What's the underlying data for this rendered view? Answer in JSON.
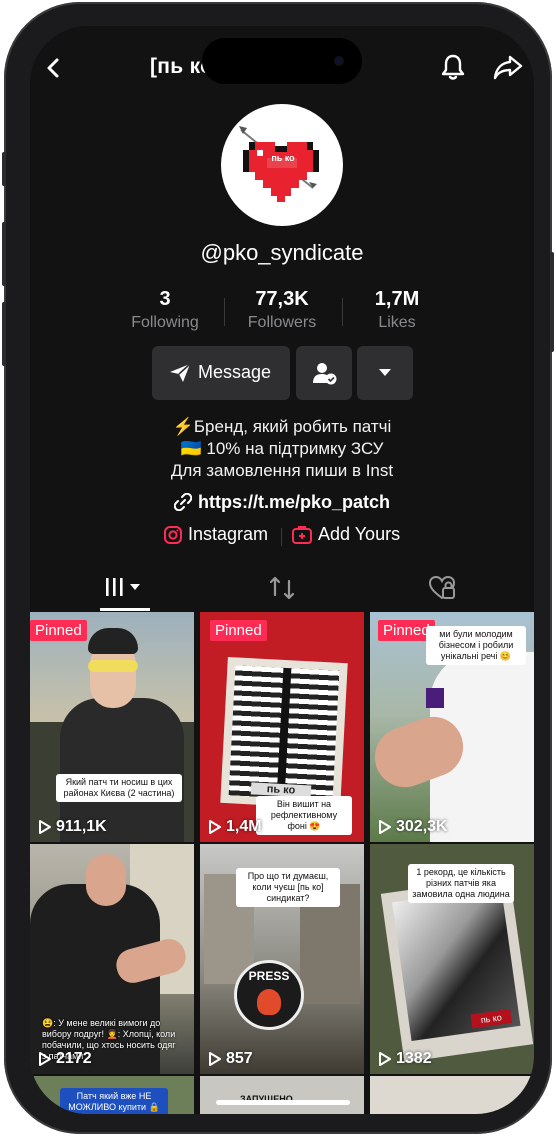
{
  "header": {
    "title": "[пь ко] синдicate",
    "back_icon": "chevron-left-icon",
    "bell_icon": "bell-icon",
    "share_icon": "share-arrow-icon"
  },
  "profile": {
    "avatar_text": "пь ко",
    "username": "@pko_syndicate",
    "stats": [
      {
        "value": "3",
        "label": "Following"
      },
      {
        "value": "77,3K",
        "label": "Followers"
      },
      {
        "value": "1,7M",
        "label": "Likes"
      }
    ],
    "message_label": "Message",
    "bio_lines": [
      "⚡Бренд, який робить патчі",
      "🇺🇦 10% на підтримку ЗСУ",
      "Для замовлення пиши в Inst"
    ],
    "link": "https://t.me/pko_patch",
    "instagram_label": "Instagram",
    "add_yours_label": "Add Yours"
  },
  "videos": [
    {
      "pinned": "Pinned",
      "views": "911,1K",
      "caption": "Який патч ти носиш в цих районах Києва (2 частина)"
    },
    {
      "pinned": "Pinned",
      "views": "1,4M",
      "caption": "Він вишит на рефлективному фоні 😍",
      "patch_text": "пь ко"
    },
    {
      "pinned": "Pinned",
      "views": "302,3K",
      "caption": "ми були молодим бізнесом і робили унікальні речі 😊"
    },
    {
      "views": "2172",
      "caption": "😫: У мене великі вимоги до вибору подруг! 🧑‍🦱: Хлопці, коли побачили, що хтось носить одяг з патчами"
    },
    {
      "views": "857",
      "caption": "Про що ти думаєш, коли чуєш [пь ко] синдикат?",
      "patch_text": "PRESS"
    },
    {
      "views": "1382",
      "caption": "1 рекорд, це кількість різних патчів яка замовила одна людина",
      "patch_text": "пь ко"
    },
    {
      "caption": "Патч який вже НЕ МОЖЛИВО купити 🔒"
    },
    {
      "caption": "ЗАПУЩЕНО"
    },
    {
      "caption": ""
    }
  ],
  "colors": {
    "background": "#121212",
    "accent": "#fe2c55",
    "button_bg": "#2f2f31",
    "muted_text": "#8a8a8e"
  }
}
